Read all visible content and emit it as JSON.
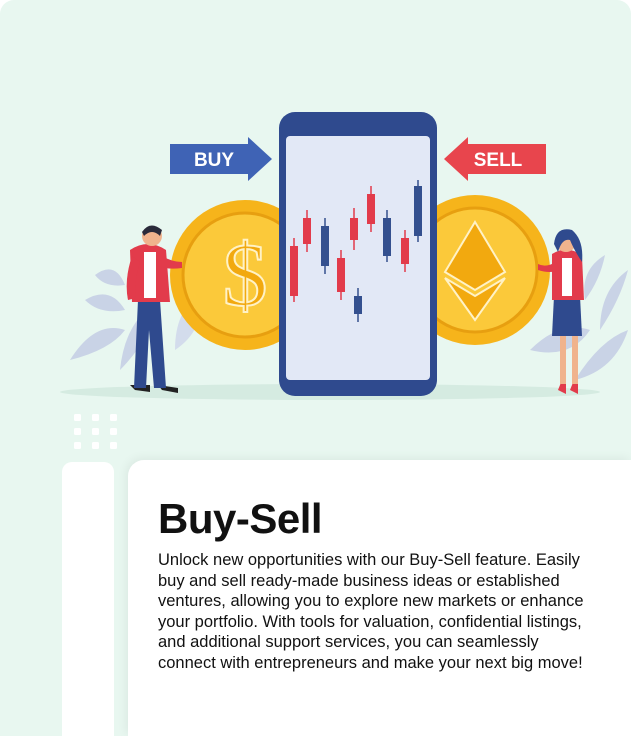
{
  "illustration": {
    "buy_label": "BUY",
    "sell_label": "SELL",
    "coin_left_symbol": "$",
    "colors": {
      "buy_arrow": "#3f63b5",
      "sell_arrow": "#e8454d",
      "coin": "#f6b41b",
      "phone_frame": "#2f4a8e",
      "candle_red": "#e23b4b",
      "candle_blue": "#34508f",
      "background": "#e8f7f0"
    },
    "icons": [
      "dollar-coin-icon",
      "ethereum-coin-icon",
      "buy-arrow-icon",
      "sell-arrow-icon",
      "phone-chart-icon"
    ]
  },
  "feature": {
    "title": "Buy-Sell",
    "description": "Unlock new opportunities with our Buy-Sell feature. Easily buy and sell ready-made business ideas or established ventures, allowing you to explore new markets or enhance your portfolio. With tools for valuation, confidential listings, and additional support services, you can seamlessly connect with entrepreneurs and make your next big move!"
  }
}
